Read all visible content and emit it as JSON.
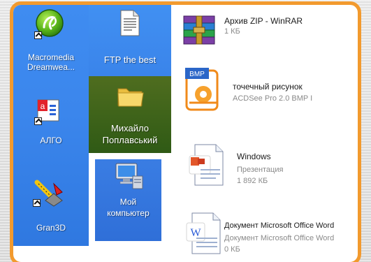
{
  "desktop_icons": [
    {
      "name": "dreamweaver",
      "label_line1": "Macromedia",
      "label_line2": "Dreamwea...",
      "icon": "dreamweaver-icon"
    },
    {
      "name": "ftp",
      "label_line1": "FTP the best",
      "icon": "text-document-icon"
    },
    {
      "name": "folder",
      "label_line1": "Михайло",
      "label_line2": "Поплавський",
      "icon": "folder-icon"
    },
    {
      "name": "algo",
      "label_line1": "АЛГО",
      "icon": "algo-app-icon"
    },
    {
      "name": "my-computer",
      "label_line1": "Мой",
      "label_line2": "компьютер",
      "icon": "computer-icon"
    },
    {
      "name": "gran3d",
      "label_line1": "Gran3D",
      "icon": "gran3d-icon"
    }
  ],
  "files": [
    {
      "name": "Архив ZIP - WinRAR",
      "meta1": "1 КБ",
      "meta2": "",
      "icon": "winrar-archive-icon"
    },
    {
      "name": "точечный рисунок",
      "meta1": "ACDSee Pro 2.0 BMP I",
      "meta2": "",
      "icon": "bmp-image-icon"
    },
    {
      "name": "Windows",
      "meta1": "Презентация",
      "meta2": "1 892 КБ",
      "icon": "powerpoint-icon"
    },
    {
      "name": "Документ Microsoft Office Word",
      "meta1": "Документ Microsoft Office Word",
      "meta2": "0 КБ",
      "icon": "word-document-icon"
    }
  ],
  "colors": {
    "frame_border": "#f29a2e",
    "desktop_blue": "#3b86ec",
    "folder_green": "#3c6118",
    "selection_blue": "#2f6fd8"
  }
}
